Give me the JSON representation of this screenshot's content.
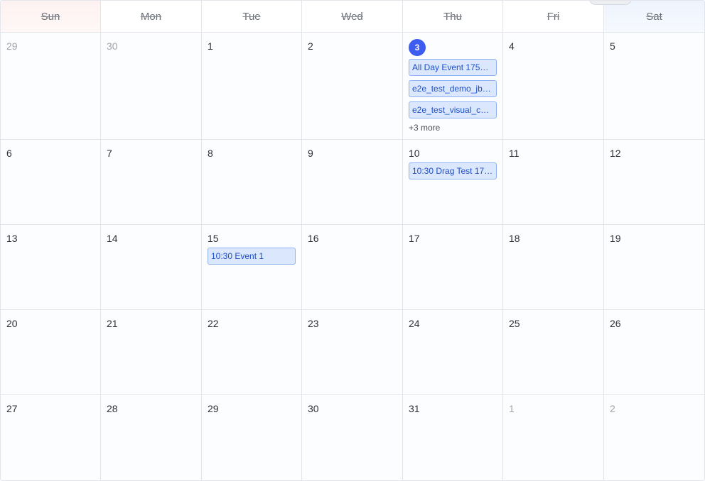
{
  "weekdays": [
    "Sun",
    "Mon",
    "Tue",
    "Wed",
    "Thu",
    "Fri",
    "Sat"
  ],
  "weeks": [
    [
      {
        "day": "29",
        "muted": true,
        "events": []
      },
      {
        "day": "30",
        "muted": true,
        "events": []
      },
      {
        "day": "1",
        "events": []
      },
      {
        "day": "2",
        "events": []
      },
      {
        "day": "3",
        "today": true,
        "events": [
          "All Day Event 1751…",
          "e2e_test_demo_jb…",
          "e2e_test_visual_c…"
        ],
        "more": "+3 more"
      },
      {
        "day": "4",
        "events": []
      },
      {
        "day": "5",
        "events": []
      }
    ],
    [
      {
        "day": "6",
        "events": []
      },
      {
        "day": "7",
        "events": []
      },
      {
        "day": "8",
        "events": []
      },
      {
        "day": "9",
        "events": []
      },
      {
        "day": "10",
        "events": [
          "10:30 Drag Test 17…"
        ]
      },
      {
        "day": "11",
        "events": []
      },
      {
        "day": "12",
        "events": []
      }
    ],
    [
      {
        "day": "13",
        "events": []
      },
      {
        "day": "14",
        "events": []
      },
      {
        "day": "15",
        "events": [
          "10:30 Event 1"
        ]
      },
      {
        "day": "16",
        "events": []
      },
      {
        "day": "17",
        "events": []
      },
      {
        "day": "18",
        "events": []
      },
      {
        "day": "19",
        "events": []
      }
    ],
    [
      {
        "day": "20",
        "events": []
      },
      {
        "day": "21",
        "events": []
      },
      {
        "day": "22",
        "events": []
      },
      {
        "day": "23",
        "events": []
      },
      {
        "day": "24",
        "events": []
      },
      {
        "day": "25",
        "events": []
      },
      {
        "day": "26",
        "events": []
      }
    ],
    [
      {
        "day": "27",
        "events": []
      },
      {
        "day": "28",
        "events": []
      },
      {
        "day": "29",
        "events": []
      },
      {
        "day": "30",
        "events": []
      },
      {
        "day": "31",
        "events": []
      },
      {
        "day": "1",
        "muted": true,
        "events": []
      },
      {
        "day": "2",
        "muted": true,
        "events": []
      }
    ]
  ],
  "colors": {
    "today_badge": "#3d5cf0",
    "event_bg": "#dbe7fd",
    "event_border": "#8fb3f2",
    "event_text": "#1e4fc7",
    "sunday_header": "#fdf2f1",
    "saturday_header": "#eef4fd"
  }
}
